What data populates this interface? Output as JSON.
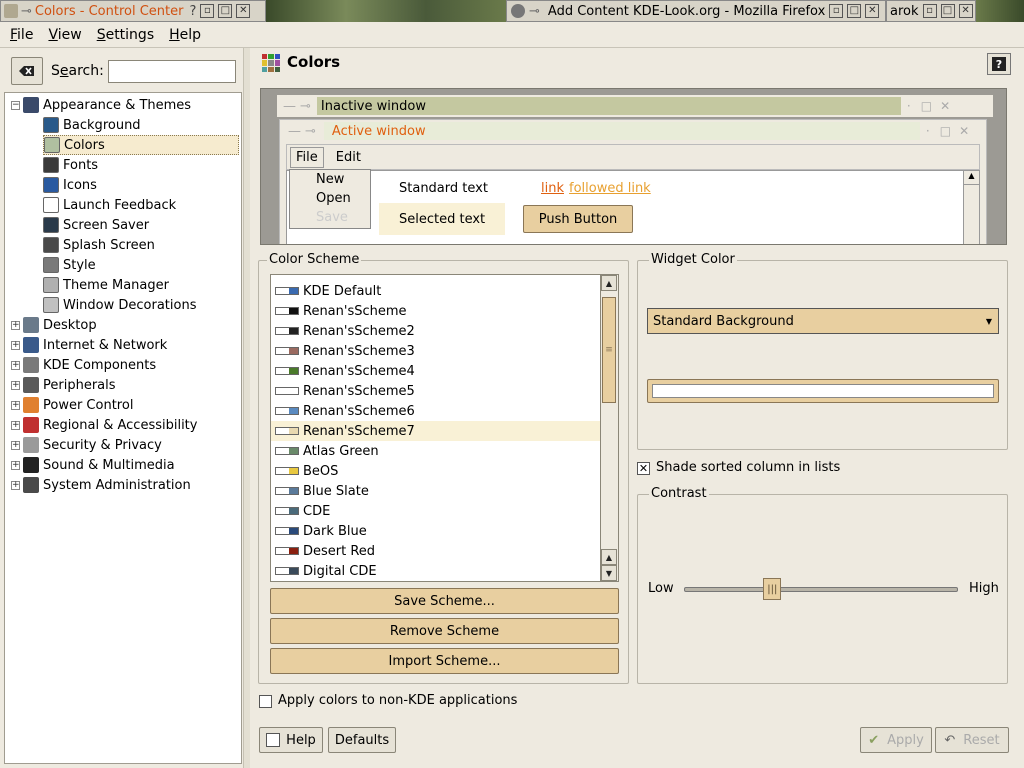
{
  "taskbar": {
    "task1": "Colors - Control Center",
    "task2": "Add Content KDE-Look.org - Mozilla Firefox",
    "task3": "arok"
  },
  "menubar": {
    "file": "File",
    "view": "View",
    "settings": "Settings",
    "help": "Help"
  },
  "search": {
    "label": "Search:",
    "value": ""
  },
  "tree": {
    "appearance": "Appearance & Themes",
    "children": [
      "Background",
      "Colors",
      "Fonts",
      "Icons",
      "Launch Feedback",
      "Screen Saver",
      "Splash Screen",
      "Style",
      "Theme Manager",
      "Window Decorations"
    ],
    "selected": "Colors",
    "categories": [
      "Desktop",
      "Internet & Network",
      "KDE Components",
      "Peripherals",
      "Power Control",
      "Regional & Accessibility",
      "Security & Privacy",
      "Sound & Multimedia",
      "System Administration"
    ]
  },
  "page": {
    "title": "Colors"
  },
  "preview": {
    "inactive_title": "Inactive window",
    "active_title": "Active window",
    "menu_file": "File",
    "menu_edit": "Edit",
    "menu_new": "New",
    "menu_open": "Open",
    "menu_save": "Save",
    "standard_text": "Standard text",
    "selected_text": "Selected text",
    "link": "link",
    "followed_link": "followed link",
    "push_button": "Push Button"
  },
  "color_scheme": {
    "title": "Color Scheme",
    "items": [
      "KDE Default",
      "Renan'sScheme",
      "Renan'sScheme2",
      "Renan'sScheme3",
      "Renan'sScheme4",
      "Renan'sScheme5",
      "Renan'sScheme6",
      "Renan'sScheme7",
      "Atlas Green",
      "BeOS",
      "Blue Slate",
      "CDE",
      "Dark Blue",
      "Desert Red",
      "Digital CDE"
    ],
    "swatches": [
      "#3a6ab0",
      "#111111",
      "#222222",
      "#9a6a60",
      "#4a7a2a",
      "#ffffff",
      "#5a8ac0",
      "#e8d8b0",
      "#6a8a6a",
      "#e8c840",
      "#5a7a9a",
      "#4a6a7a",
      "#2a4a7a",
      "#8a2010",
      "#3a4a5a"
    ],
    "selected": "Renan'sScheme7",
    "save": "Save Scheme...",
    "remove": "Remove Scheme",
    "import": "Import Scheme..."
  },
  "widget_color": {
    "title": "Widget Color",
    "selected": "Standard Background"
  },
  "shade_sorted": {
    "label": "Shade sorted column in lists",
    "checked": true
  },
  "contrast": {
    "title": "Contrast",
    "low": "Low",
    "high": "High",
    "value": 0.31
  },
  "apply_non_kde": {
    "label": "Apply colors to non-KDE applications",
    "checked": false
  },
  "buttons": {
    "help": "Help",
    "defaults": "Defaults",
    "apply": "Apply",
    "reset": "Reset"
  }
}
